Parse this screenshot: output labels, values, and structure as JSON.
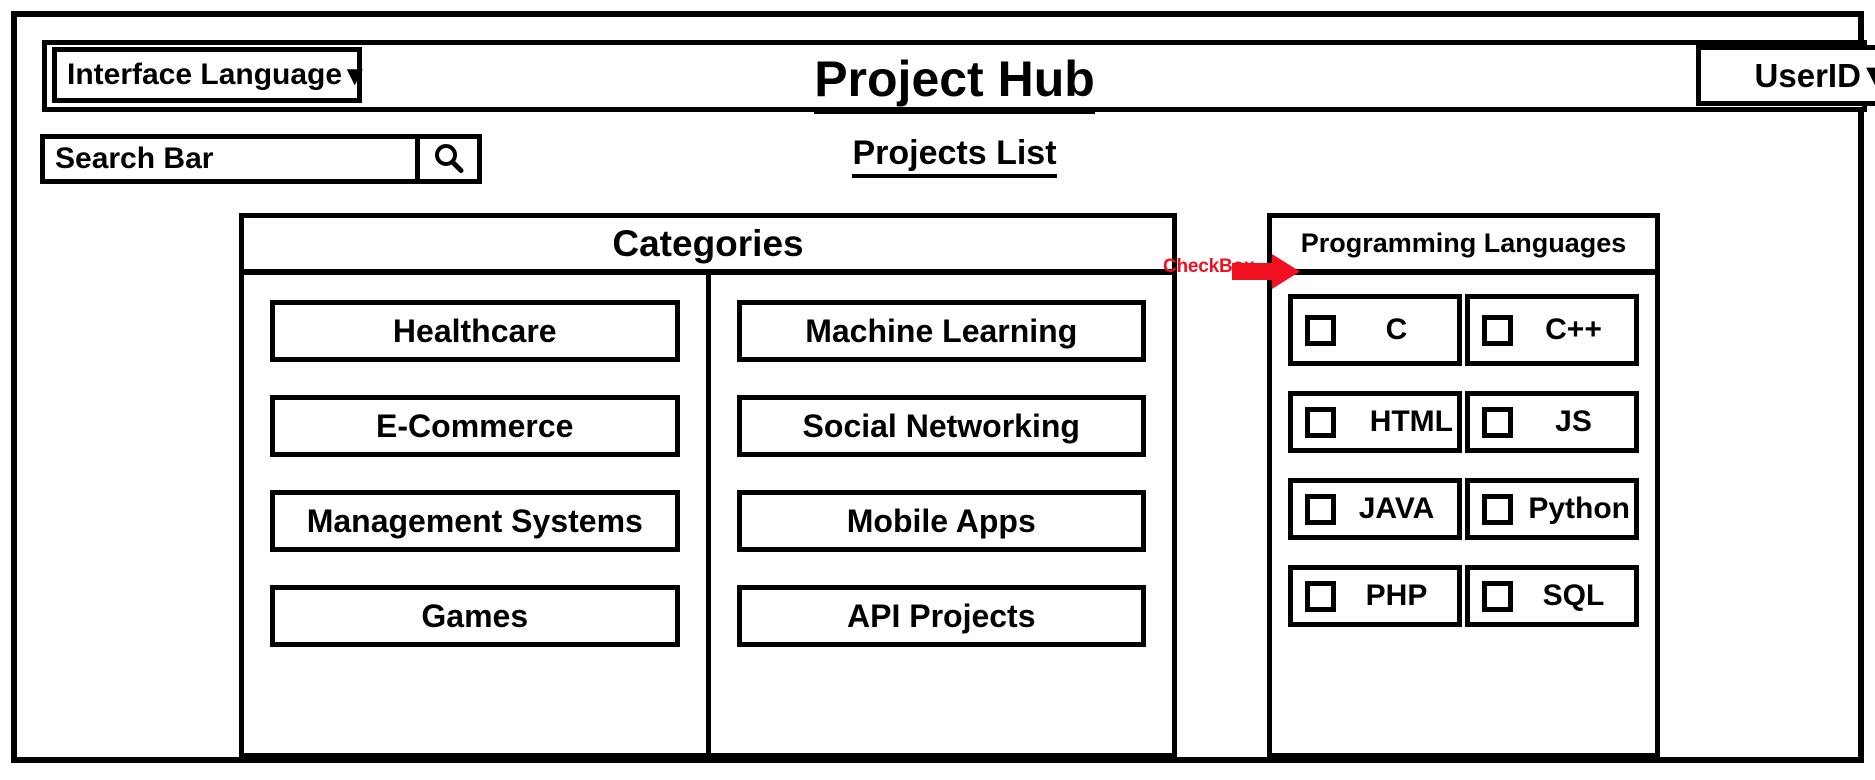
{
  "window": {
    "title": "Project Hub"
  },
  "header": {
    "interface_language": {
      "label": "Interface Language",
      "caret": "▼"
    },
    "user": {
      "label": "UserID",
      "caret": "▼"
    },
    "title": "Project Hub"
  },
  "search": {
    "text": "Search Bar",
    "icon": "search-icon"
  },
  "section": {
    "title": "Projects List"
  },
  "categories": {
    "header": "Categories",
    "left_column": [
      {
        "label": "Healthcare"
      },
      {
        "label": "E-Commerce"
      },
      {
        "label": "Management Systems"
      },
      {
        "label": "Games"
      }
    ],
    "right_column": [
      {
        "label": "Machine Learning"
      },
      {
        "label": "Social Networking"
      },
      {
        "label": "Mobile Apps"
      },
      {
        "label": "API Projects"
      }
    ]
  },
  "languages": {
    "header": "Programming Languages",
    "rows": [
      [
        {
          "label": "C",
          "checked": false
        },
        {
          "label": "C++",
          "checked": false
        }
      ],
      [
        {
          "label": "HTML",
          "checked": false
        },
        {
          "label": "JS",
          "checked": false
        }
      ],
      [
        {
          "label": "JAVA",
          "checked": false
        },
        {
          "label": "Python",
          "checked": false
        }
      ],
      [
        {
          "label": "PHP",
          "checked": false
        },
        {
          "label": "SQL",
          "checked": false
        }
      ]
    ]
  },
  "annotation": {
    "checkbox_label": "CheckBox",
    "color": "#f01020"
  }
}
